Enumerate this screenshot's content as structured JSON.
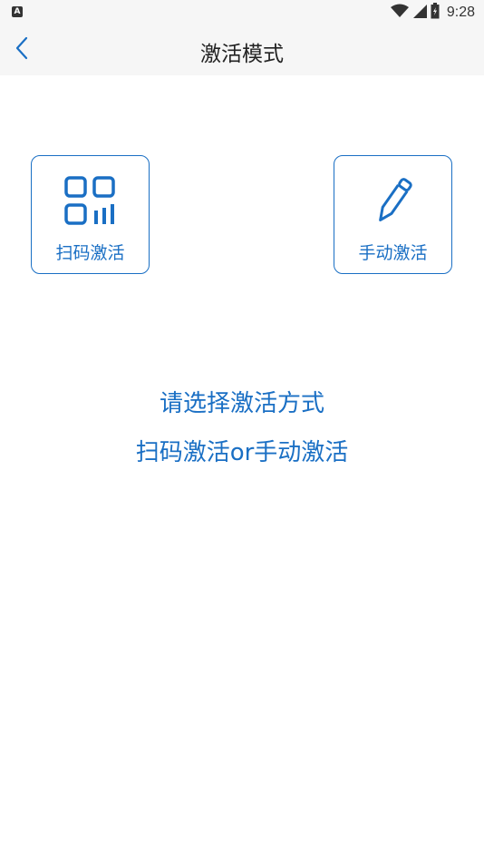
{
  "status_bar": {
    "left_icon": "A",
    "time": "9:28",
    "icons": [
      "wifi-icon",
      "signal-icon",
      "battery-icon"
    ]
  },
  "header": {
    "title": "激活模式",
    "back_icon": "chevron-left-icon"
  },
  "modes": [
    {
      "label": "扫码激活",
      "icon": "qr-code-icon"
    },
    {
      "label": "手动激活",
      "icon": "pencil-icon"
    }
  ],
  "hint": {
    "line1": "请选择激活方式",
    "line2": "扫码激活or手动激活"
  },
  "colors": {
    "accent": "#1a6fc4",
    "header_bg": "#f6f6f6",
    "title_text": "#222222"
  }
}
